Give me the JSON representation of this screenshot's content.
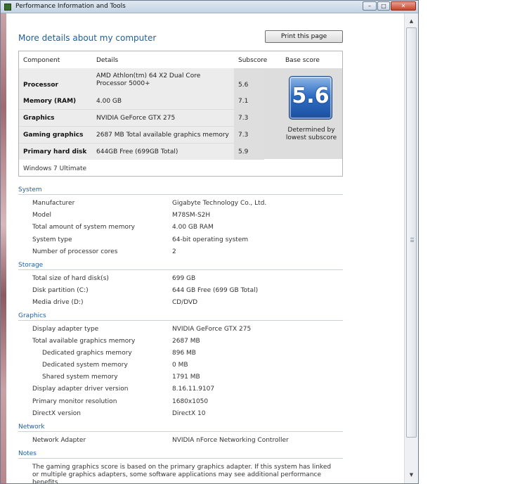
{
  "window": {
    "title": "Performance Information and Tools",
    "min_glyph": "–",
    "max_glyph": "□",
    "close_glyph": "✕"
  },
  "page": {
    "heading": "More details about my computer",
    "print_label": "Print this page"
  },
  "score_table": {
    "headers": [
      "Component",
      "Details",
      "Subscore",
      "Base score"
    ],
    "rows": [
      {
        "component": "Processor",
        "details": "AMD Athlon(tm) 64 X2 Dual Core Processor 5000+",
        "subscore": "5.6"
      },
      {
        "component": "Memory (RAM)",
        "details": "4.00 GB",
        "subscore": "7.1"
      },
      {
        "component": "Graphics",
        "details": "NVIDIA GeForce GTX 275",
        "subscore": "7.3"
      },
      {
        "component": "Gaming graphics",
        "details": "2687 MB Total available graphics memory",
        "subscore": "7.3"
      },
      {
        "component": "Primary hard disk",
        "details": "644GB Free (699GB Total)",
        "subscore": "5.9"
      }
    ],
    "base_score": "5.6",
    "determined_line1": "Determined by",
    "determined_line2": "lowest subscore",
    "edition": "Windows 7 Ultimate"
  },
  "sections": {
    "system": {
      "title": "System",
      "items": [
        {
          "label": "Manufacturer",
          "value": "Gigabyte Technology Co., Ltd."
        },
        {
          "label": "Model",
          "value": "M78SM-S2H"
        },
        {
          "label": "Total amount of system memory",
          "value": "4.00 GB RAM"
        },
        {
          "label": "System type",
          "value": "64-bit operating system"
        },
        {
          "label": "Number of processor cores",
          "value": "2"
        }
      ]
    },
    "storage": {
      "title": "Storage",
      "items": [
        {
          "label": "Total size of hard disk(s)",
          "value": "699 GB"
        },
        {
          "label": "Disk partition (C:)",
          "value": "644 GB Free (699 GB Total)"
        },
        {
          "label": "Media drive (D:)",
          "value": "CD/DVD"
        }
      ]
    },
    "graphics": {
      "title": "Graphics",
      "items": [
        {
          "label": "Display adapter type",
          "value": "NVIDIA GeForce GTX 275"
        },
        {
          "label": "Total available graphics memory",
          "value": "2687 MB"
        },
        {
          "label": "Dedicated graphics memory",
          "value": "896 MB"
        },
        {
          "label": "Dedicated system memory",
          "value": "0 MB"
        },
        {
          "label": "Shared system memory",
          "value": "1791 MB"
        },
        {
          "label": "Display adapter driver version",
          "value": "8.16.11.9107"
        },
        {
          "label": "Primary monitor resolution",
          "value": "1680x1050"
        },
        {
          "label": "DirectX version",
          "value": "DirectX 10"
        }
      ]
    },
    "network": {
      "title": "Network",
      "items": [
        {
          "label": "Network Adapter",
          "value": "NVIDIA nForce Networking Controller"
        }
      ]
    },
    "notes": {
      "title": "Notes",
      "text": "The gaming graphics score is based on the primary graphics adapter. If this system has linked or multiple graphics adapters, some software applications may see additional performance benefits."
    }
  },
  "scrollbar": {
    "up_glyph": "▲",
    "down_glyph": "▼"
  }
}
